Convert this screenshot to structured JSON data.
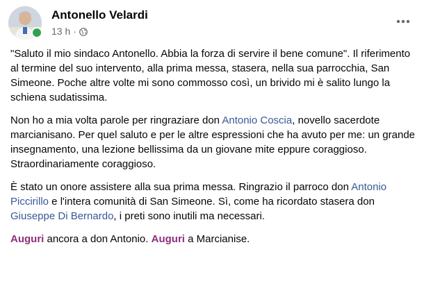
{
  "post": {
    "author": "Antonello Velardi",
    "time": "13 h",
    "separator": "·",
    "paragraphs": [
      {
        "t1": "\"Saluto il mio sindaco Antonello. Abbia la forza di servire il bene comune\". Il riferimento al termine del suo intervento, alla prima messa, stasera, nella sua parrocchia, San Simeone. Poche altre volte mi sono commosso così, un brivido mi è salito lungo la schiena sudatissima."
      },
      {
        "t1": "Non ho a mia volta parole per ringraziare don ",
        "mention1": "Antonio Coscia",
        "t2": ", novello sacerdote marcianisano. Per quel saluto e per le altre espressioni che ha avuto per  me: un grande insegnamento, una lezione bellissima da un giovane mite eppure coraggioso. Straordinariamente coraggioso."
      },
      {
        "t1": "È stato un onore assistere alla sua prima messa. Ringrazio il parroco don ",
        "mention1": "Antonio Piccirillo",
        "t2": " e l'intera comunità di San Simeone. Sì, come ha ricordato stasera don ",
        "mention2": "Giuseppe Di Bernardo",
        "t3": ", i preti sono inutili ma necessari."
      },
      {
        "tag1": "Auguri",
        "t1": " ancora a don Antonio. ",
        "tag2": "Auguri",
        "t2": " a Marcianise."
      }
    ]
  },
  "icons": {
    "globe": "globe-icon",
    "more": "more-horizontal-icon",
    "online": "online-status-dot"
  },
  "colors": {
    "mention": "#385898",
    "hashtag": "#8f2e7a",
    "meta": "#65676b",
    "online": "#31a24c"
  }
}
